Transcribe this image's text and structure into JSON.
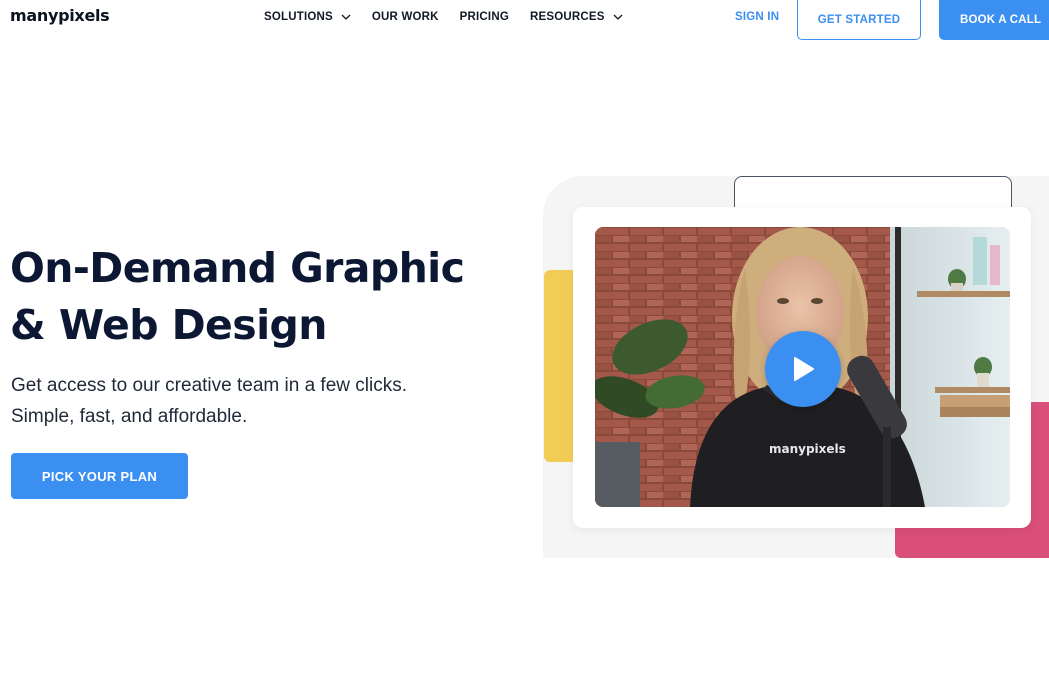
{
  "nav": {
    "logo": "manypixels",
    "links": [
      {
        "label": "SOLUTIONS",
        "has_dropdown": true
      },
      {
        "label": "OUR WORK",
        "has_dropdown": false
      },
      {
        "label": "PRICING",
        "has_dropdown": false
      },
      {
        "label": "RESOURCES",
        "has_dropdown": true
      }
    ],
    "sign_in": "SIGN IN",
    "get_started": "GET STARTED",
    "book_call": "BOOK A CALL"
  },
  "hero": {
    "title_line1": "On-Demand Graphic",
    "title_line2": "& Web Design",
    "subtitle_line1": "Get access to our creative team in a few clicks.",
    "subtitle_line2": "Simple, fast, and affordable.",
    "cta": "PICK YOUR PLAN"
  },
  "video": {
    "hoodie_text": "manypixels",
    "play_icon": "play-icon"
  },
  "colors": {
    "accent": "#3b8ff0",
    "heading": "#0b1733",
    "yellow": "#f2cd56",
    "pink": "#d94f7a"
  }
}
